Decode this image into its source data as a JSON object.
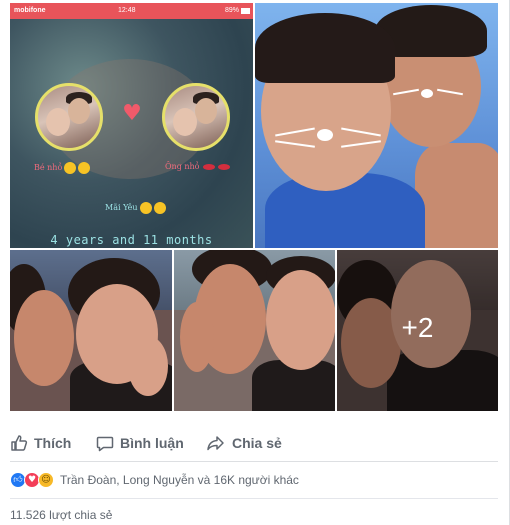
{
  "phone": {
    "carrier": "mobifone",
    "time": "12:48",
    "battery": "89%",
    "label_left": "Bé nhỏ",
    "label_right": "Ông nhỏ",
    "label_center": "Mãi Yêu",
    "caption": "4 years and 11 months"
  },
  "gallery": {
    "more_count": "+2"
  },
  "actions": {
    "like": "Thích",
    "comment": "Bình luận",
    "share": "Chia sẻ"
  },
  "reactions": {
    "names": "Trần Đoàn, Long Nguyễn và 16K người khác",
    "icons": [
      "like-icon",
      "love-icon",
      "haha-icon"
    ]
  },
  "shares": {
    "text": "11.526 lượt chia sẻ"
  },
  "colors": {
    "action_text": "#606770",
    "like_blue": "#2078f4",
    "love_red": "#f33e58",
    "haha_yellow": "#f7b928",
    "status_bar": "#e8545a"
  }
}
